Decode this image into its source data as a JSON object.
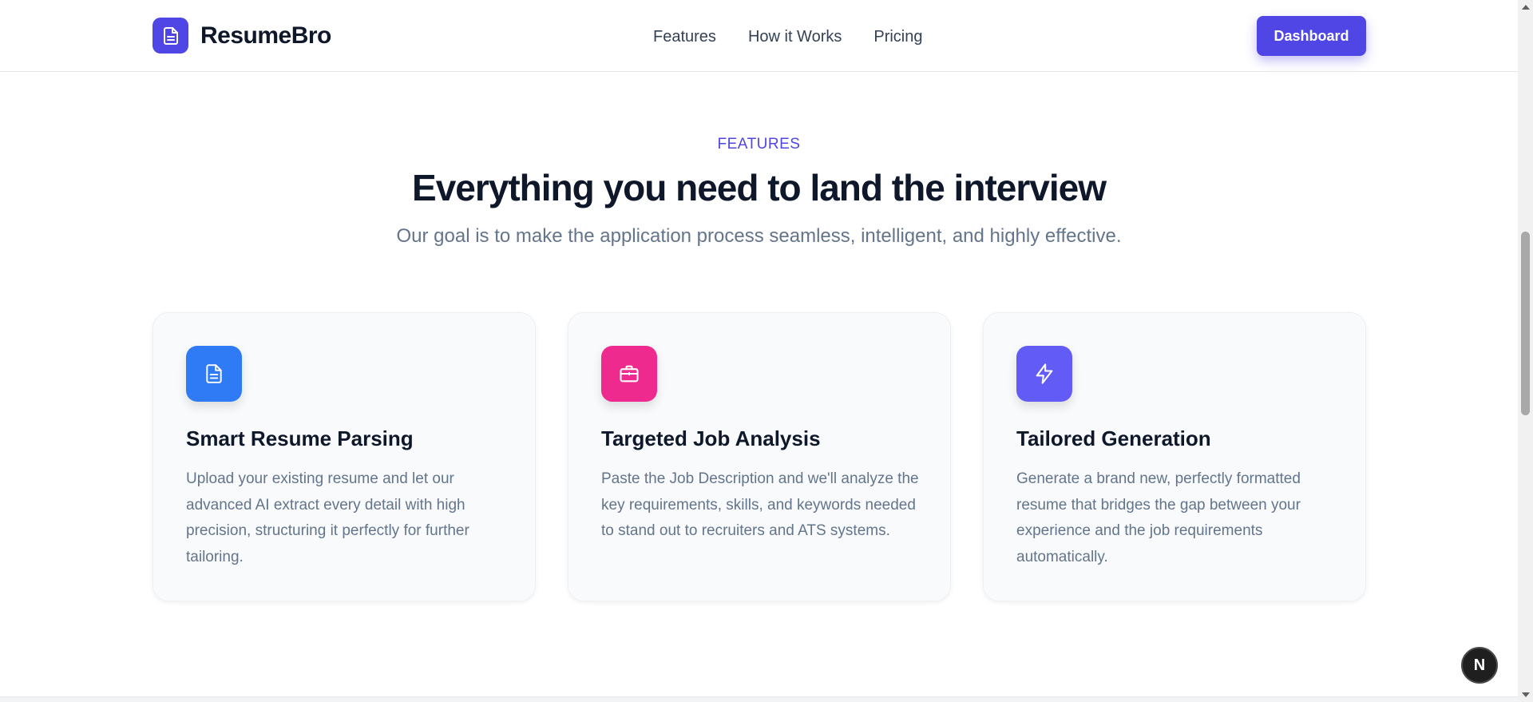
{
  "brand": {
    "name": "ResumeBro",
    "accent": "#4f46e5"
  },
  "nav": {
    "links": [
      "Features",
      "How it Works",
      "Pricing"
    ],
    "dashboard_label": "Dashboard"
  },
  "features": {
    "eyebrow": "FEATURES",
    "title": "Everything you need to land the interview",
    "subtitle": "Our goal is to make the application process seamless, intelligent, and highly effective.",
    "cards": [
      {
        "icon": "file-text-icon",
        "color": "#2f7bf5",
        "title": "Smart Resume Parsing",
        "body": "Upload your existing resume and let our advanced AI extract every detail with high precision, structuring it perfectly for further tailoring."
      },
      {
        "icon": "briefcase-icon",
        "color": "#ee2a8e",
        "title": "Targeted Job Analysis",
        "body": "Paste the Job Description and we'll analyze the key requirements, skills, and keywords needed to stand out to recruiters and ATS systems."
      },
      {
        "icon": "lightning-icon",
        "color": "#635bf5",
        "title": "Tailored Generation",
        "body": "Generate a brand new, perfectly formatted resume that bridges the gap between your experience and the job requirements automatically."
      }
    ]
  },
  "badge": {
    "label": "N"
  }
}
